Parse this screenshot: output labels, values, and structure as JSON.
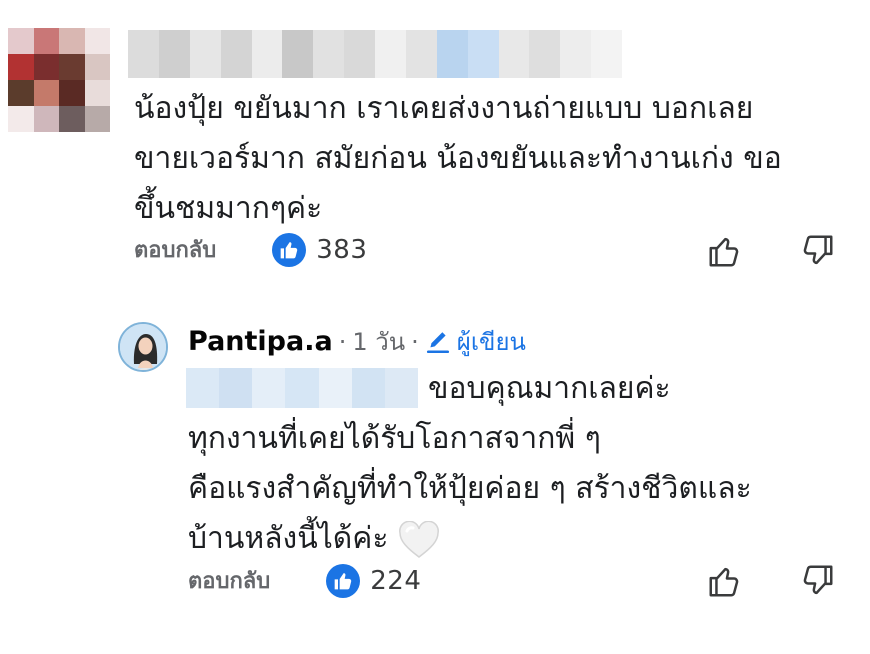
{
  "comment": {
    "lines": [
      "น้องปุ้ย ขยันมาก เราเคยส่งงานถ่ายแบบ บอกเลย",
      "ขายเวอร์มาก สมัยก่อน น้องขยันและทำงานเก่ง ขอ",
      "ขึ้นชมมากๆค่ะ"
    ],
    "reply_label": "ตอบกลับ",
    "like_count": "383"
  },
  "reply": {
    "author": "Pantipa.a",
    "time": "1 วัน",
    "author_badge": "ผู้เขียน",
    "lines": [
      "ขอบคุณมากเลยค่ะ",
      "ทุกงานที่เคยได้รับโอกาสจากพี่ ๆ",
      "คือแรงสำคัญที่ทำให้ปุ้ยค่อย ๆ สร้างชีวิตและ",
      "บ้านหลังนี้ได้ค่ะ"
    ],
    "reply_label": "ตอบกลับ",
    "like_count": "224"
  },
  "colors": {
    "accent": "#1b74e4",
    "muted_text": "#65676b",
    "body_text": "#1c1e21"
  },
  "icons": {
    "like_badge": "thumbs-up-filled-icon",
    "like": "thumbs-up-outline-icon",
    "dislike": "thumbs-down-outline-icon",
    "edit": "pencil-icon",
    "heart": "white-heart-emoji"
  }
}
